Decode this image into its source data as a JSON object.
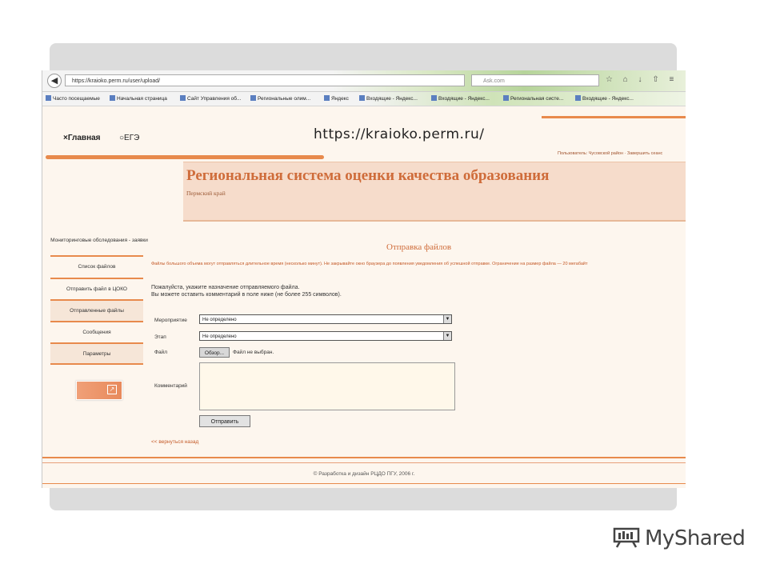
{
  "browser": {
    "url": "https://kraioko.perm.ru/user/upload/",
    "search_placeholder": "Ask.com",
    "bookmarks": [
      "Часто посещаемые",
      "Начальная страница",
      "Сайт Управления об...",
      "Региональные олим...",
      "Яндекс",
      "Входящие - Яндекс...",
      "Входящие - Яндекс...",
      "Региональная систе...",
      "Входящие - Яндекс..."
    ]
  },
  "caption_url": "https://kraioko.perm.ru/",
  "top_nav": {
    "home": "Главная",
    "ege": "ЕГЭ"
  },
  "user_bar": "Пользователь: Чусовской район · Завершить сеанс",
  "header": {
    "title": "Региональная система оценки качества образования",
    "region": "Пермский край"
  },
  "sidebar": {
    "monitoring": "Мониторинговые обследования - заявки",
    "items": [
      {
        "label": "Список файлов"
      },
      {
        "label": "Отправить файл в ЦОКО"
      },
      {
        "label": "Отправленные файлы"
      },
      {
        "label": "Сообщения"
      },
      {
        "label": "Параметры"
      }
    ]
  },
  "main": {
    "heading": "Отправка файлов",
    "warning": "Файлы большого объема могут отправляться длительное время (несколько минут). Не закрывайте окно браузера до появления уведомления об успешной отправке. Ограничение на размер файла — 20 мегабайт",
    "instruction_1": "Пожалуйста, укажите назначение отправляемого файла.",
    "instruction_2": "Вы можете оставить комментарий в поле ниже (не более 255 символов).",
    "event_label": "Мероприятие",
    "event_value": "Не определено",
    "stage_label": "Этап",
    "stage_value": "Не определено",
    "file_label": "Файл",
    "browse_label": "Обзор...",
    "file_status": "Файл не выбран.",
    "comment_label": "Комментарий",
    "submit_label": "Отправить",
    "back_link": "<< вернуться назад"
  },
  "footer": "© Разработка и дизайн РЦДО ПГУ, 2006 г.",
  "watermark": "MyShared",
  "colors": {
    "accent": "#e88a4c",
    "title": "#cf6c3a",
    "panel": "#f6dccb",
    "page_bg": "#fdf6ee"
  }
}
